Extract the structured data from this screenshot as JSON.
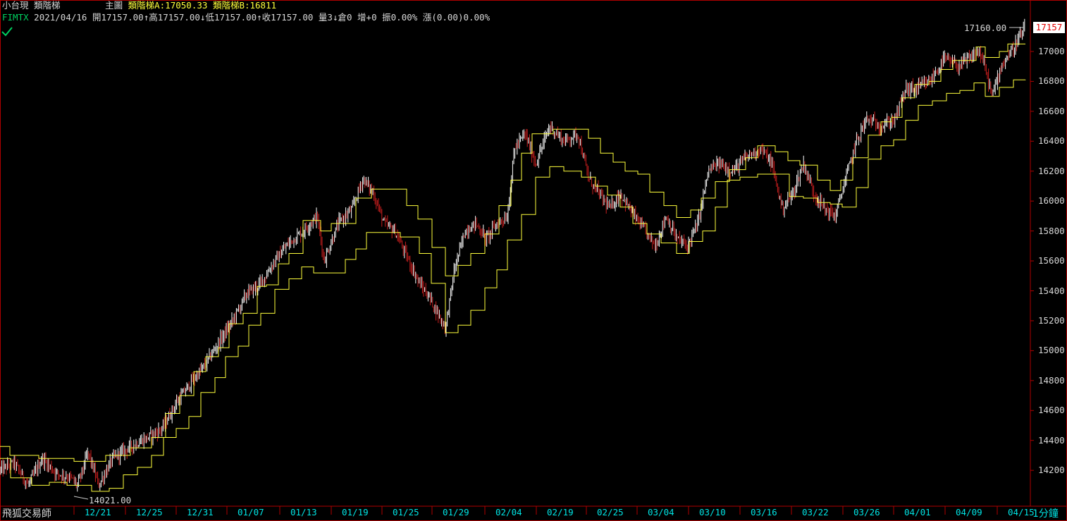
{
  "header": {
    "symbol_name": "小台現",
    "indicator_name": "類階梯",
    "panel": "主圖",
    "ladder_a": "類階梯A:17050.33",
    "ladder_b": "類階梯B:16811"
  },
  "quote": {
    "code": "FIMTX",
    "date": "2021/04/16",
    "open": "開17157.00",
    "high": "↑高17157.00",
    "low": "↓低17157.00",
    "close": "↑收17157.00",
    "volume": "量3",
    "open_interest": "↓倉0",
    "change_oi": "增+0",
    "amplitude": "振0.00%",
    "change": "漲(0.00)0.00%"
  },
  "footer": {
    "app_name": "飛狐交易師",
    "period": "1分鐘"
  },
  "colors": {
    "background": "#000000",
    "frame": "#b00000",
    "ladder": "#ffff3c",
    "candle_up": "#ffffff",
    "candle_down": "#c81e1e",
    "axis_text": "#00e5e5"
  },
  "icons": {
    "status": "checkmark-icon"
  },
  "price_tag": "17157",
  "high_label": "17160.00",
  "low_label": "14021.00",
  "chart_data": {
    "type": "candlestick",
    "ylim": [
      14000,
      17200
    ],
    "y_ticks": [
      14200,
      14400,
      14600,
      14800,
      15000,
      15200,
      15400,
      15600,
      15800,
      16000,
      16200,
      16400,
      16600,
      16800,
      17000
    ],
    "x_ticks": [
      "12/21",
      "12/25",
      "12/31",
      "01/07",
      "01/13",
      "01/19",
      "01/25",
      "01/29",
      "02/04",
      "02/19",
      "02/25",
      "03/04",
      "03/10",
      "03/16",
      "03/22",
      "03/26",
      "04/01",
      "04/09",
      "04/15"
    ],
    "last": 17157,
    "high": 17160,
    "low": 14021,
    "price_path": [
      [
        0,
        14200
      ],
      [
        20,
        14250
      ],
      [
        40,
        14100
      ],
      [
        60,
        14280
      ],
      [
        80,
        14180
      ],
      [
        100,
        14150
      ],
      [
        110,
        14100
      ],
      [
        125,
        14320
      ],
      [
        140,
        14100
      ],
      [
        160,
        14280
      ],
      [
        185,
        14360
      ],
      [
        210,
        14420
      ],
      [
        230,
        14480
      ],
      [
        250,
        14650
      ],
      [
        270,
        14780
      ],
      [
        290,
        14900
      ],
      [
        310,
        15050
      ],
      [
        330,
        15200
      ],
      [
        350,
        15380
      ],
      [
        370,
        15450
      ],
      [
        390,
        15600
      ],
      [
        410,
        15720
      ],
      [
        430,
        15800
      ],
      [
        450,
        15900
      ],
      [
        460,
        15600
      ],
      [
        480,
        15850
      ],
      [
        500,
        15950
      ],
      [
        515,
        16150
      ],
      [
        530,
        16050
      ],
      [
        545,
        15850
      ],
      [
        560,
        15800
      ],
      [
        575,
        15650
      ],
      [
        595,
        15450
      ],
      [
        610,
        15350
      ],
      [
        632,
        15150
      ],
      [
        645,
        15550
      ],
      [
        660,
        15800
      ],
      [
        675,
        15850
      ],
      [
        690,
        15750
      ],
      [
        705,
        15850
      ],
      [
        720,
        15900
      ],
      [
        730,
        16350
      ],
      [
        745,
        16450
      ],
      [
        760,
        16250
      ],
      [
        780,
        16500
      ],
      [
        800,
        16400
      ],
      [
        820,
        16450
      ],
      [
        835,
        16150
      ],
      [
        850,
        16050
      ],
      [
        865,
        15950
      ],
      [
        880,
        16050
      ],
      [
        900,
        15900
      ],
      [
        915,
        15800
      ],
      [
        930,
        15700
      ],
      [
        945,
        15900
      ],
      [
        960,
        15750
      ],
      [
        975,
        15700
      ],
      [
        990,
        15850
      ],
      [
        1005,
        16200
      ],
      [
        1020,
        16250
      ],
      [
        1040,
        16200
      ],
      [
        1060,
        16300
      ],
      [
        1080,
        16350
      ],
      [
        1095,
        16250
      ],
      [
        1110,
        15950
      ],
      [
        1125,
        16050
      ],
      [
        1140,
        16250
      ],
      [
        1155,
        16050
      ],
      [
        1170,
        15950
      ],
      [
        1185,
        15900
      ],
      [
        1200,
        16150
      ],
      [
        1215,
        16400
      ],
      [
        1230,
        16550
      ],
      [
        1250,
        16500
      ],
      [
        1270,
        16550
      ],
      [
        1285,
        16750
      ],
      [
        1300,
        16750
      ],
      [
        1320,
        16800
      ],
      [
        1340,
        16950
      ],
      [
        1360,
        16900
      ],
      [
        1375,
        16950
      ],
      [
        1390,
        17000
      ],
      [
        1400,
        16850
      ],
      [
        1408,
        16700
      ],
      [
        1420,
        16900
      ],
      [
        1435,
        17000
      ],
      [
        1450,
        17120
      ],
      [
        1455,
        17157
      ]
    ],
    "series": [
      {
        "name": "類階梯A",
        "steps": [
          [
            0,
            14360
          ],
          [
            14,
            14300
          ],
          [
            55,
            14280
          ],
          [
            105,
            14260
          ],
          [
            150,
            14300
          ],
          [
            185,
            14350
          ],
          [
            215,
            14420
          ],
          [
            235,
            14580
          ],
          [
            255,
            14700
          ],
          [
            275,
            14860
          ],
          [
            292,
            14960
          ],
          [
            310,
            15020
          ],
          [
            325,
            15180
          ],
          [
            345,
            15250
          ],
          [
            365,
            15430
          ],
          [
            378,
            15440
          ],
          [
            395,
            15580
          ],
          [
            410,
            15650
          ],
          [
            430,
            15870
          ],
          [
            455,
            15800
          ],
          [
            470,
            15850
          ],
          [
            505,
            16020
          ],
          [
            527,
            16080
          ],
          [
            560,
            16080
          ],
          [
            577,
            15970
          ],
          [
            593,
            15880
          ],
          [
            613,
            15690
          ],
          [
            632,
            15500
          ],
          [
            650,
            15570
          ],
          [
            668,
            15650
          ],
          [
            688,
            15780
          ],
          [
            708,
            15970
          ],
          [
            725,
            16140
          ],
          [
            740,
            16320
          ],
          [
            755,
            16450
          ],
          [
            785,
            16480
          ],
          [
            812,
            16480
          ],
          [
            835,
            16420
          ],
          [
            852,
            16320
          ],
          [
            870,
            16260
          ],
          [
            887,
            16200
          ],
          [
            905,
            16180
          ],
          [
            922,
            16060
          ],
          [
            942,
            15970
          ],
          [
            960,
            15890
          ],
          [
            980,
            15940
          ],
          [
            995,
            16020
          ],
          [
            1015,
            16130
          ],
          [
            1035,
            16210
          ],
          [
            1058,
            16290
          ],
          [
            1075,
            16370
          ],
          [
            1100,
            16330
          ],
          [
            1118,
            16270
          ],
          [
            1135,
            16240
          ],
          [
            1160,
            16140
          ],
          [
            1178,
            16070
          ],
          [
            1193,
            16140
          ],
          [
            1210,
            16290
          ],
          [
            1232,
            16440
          ],
          [
            1250,
            16530
          ],
          [
            1265,
            16560
          ],
          [
            1280,
            16690
          ],
          [
            1298,
            16780
          ],
          [
            1318,
            16800
          ],
          [
            1335,
            16880
          ],
          [
            1352,
            16940
          ],
          [
            1385,
            17030
          ],
          [
            1398,
            16960
          ],
          [
            1418,
            17000
          ],
          [
            1430,
            17050
          ],
          [
            1455,
            17050
          ]
        ]
      },
      {
        "name": "類階梯B",
        "steps": [
          [
            0,
            14280
          ],
          [
            15,
            14150
          ],
          [
            45,
            14100
          ],
          [
            70,
            14120
          ],
          [
            95,
            14100
          ],
          [
            130,
            14060
          ],
          [
            155,
            14080
          ],
          [
            175,
            14170
          ],
          [
            195,
            14220
          ],
          [
            215,
            14300
          ],
          [
            232,
            14420
          ],
          [
            250,
            14480
          ],
          [
            268,
            14560
          ],
          [
            285,
            14720
          ],
          [
            305,
            14820
          ],
          [
            320,
            14960
          ],
          [
            338,
            15030
          ],
          [
            353,
            15170
          ],
          [
            370,
            15250
          ],
          [
            390,
            15410
          ],
          [
            410,
            15480
          ],
          [
            428,
            15560
          ],
          [
            445,
            15520
          ],
          [
            465,
            15520
          ],
          [
            490,
            15610
          ],
          [
            505,
            15680
          ],
          [
            520,
            15790
          ],
          [
            542,
            15790
          ],
          [
            568,
            15760
          ],
          [
            595,
            15650
          ],
          [
            612,
            15450
          ],
          [
            632,
            15120
          ],
          [
            650,
            15170
          ],
          [
            668,
            15270
          ],
          [
            688,
            15420
          ],
          [
            705,
            15540
          ],
          [
            720,
            15740
          ],
          [
            740,
            15910
          ],
          [
            760,
            16160
          ],
          [
            780,
            16230
          ],
          [
            800,
            16200
          ],
          [
            825,
            16160
          ],
          [
            845,
            16100
          ],
          [
            862,
            16040
          ],
          [
            880,
            15960
          ],
          [
            898,
            15850
          ],
          [
            918,
            15780
          ],
          [
            938,
            15720
          ],
          [
            960,
            15650
          ],
          [
            978,
            15730
          ],
          [
            997,
            15800
          ],
          [
            1015,
            15960
          ],
          [
            1032,
            16140
          ],
          [
            1050,
            16160
          ],
          [
            1075,
            16180
          ],
          [
            1100,
            16180
          ],
          [
            1120,
            16030
          ],
          [
            1140,
            16020
          ],
          [
            1160,
            15990
          ],
          [
            1178,
            15980
          ],
          [
            1195,
            15960
          ],
          [
            1215,
            16090
          ],
          [
            1232,
            16280
          ],
          [
            1250,
            16370
          ],
          [
            1268,
            16410
          ],
          [
            1285,
            16540
          ],
          [
            1303,
            16640
          ],
          [
            1323,
            16670
          ],
          [
            1343,
            16720
          ],
          [
            1362,
            16740
          ],
          [
            1382,
            16790
          ],
          [
            1398,
            16700
          ],
          [
            1418,
            16760
          ],
          [
            1438,
            16810
          ],
          [
            1455,
            16811
          ]
        ]
      }
    ]
  }
}
